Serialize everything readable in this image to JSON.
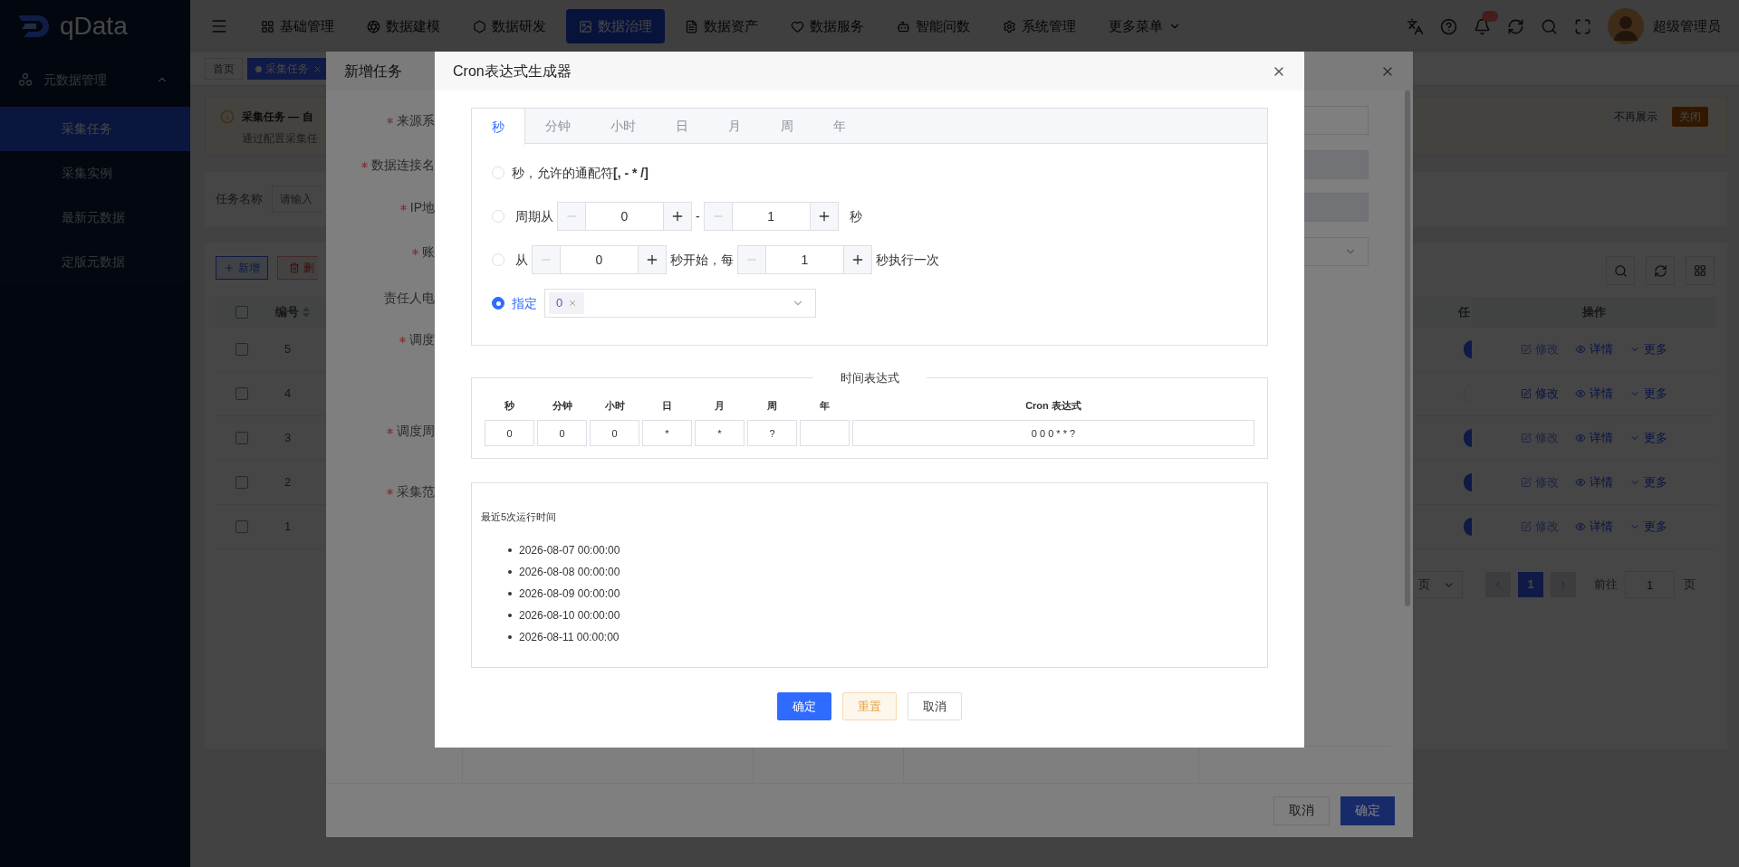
{
  "header": {
    "logo": "qData",
    "nav": [
      {
        "label": "基础管理",
        "selected": false
      },
      {
        "label": "数据建模",
        "selected": false
      },
      {
        "label": "数据研发",
        "selected": false
      },
      {
        "label": "数据治理",
        "selected": true
      },
      {
        "label": "数据资产",
        "selected": false
      },
      {
        "label": "数据服务",
        "selected": false
      },
      {
        "label": "智能问数",
        "selected": false
      },
      {
        "label": "系统管理",
        "selected": false
      }
    ],
    "more": "更多菜单",
    "user": "超级管理员"
  },
  "page_tabs": [
    {
      "label": "首页",
      "selected": false,
      "closable": false
    },
    {
      "label": "采集任务",
      "selected": true,
      "closable": true
    }
  ],
  "sidebar": {
    "group": "元数据管理",
    "expanded": true,
    "items": [
      {
        "label": "采集任务",
        "selected": true
      },
      {
        "label": "采集实例",
        "selected": false
      },
      {
        "label": "最新元数据",
        "selected": false
      },
      {
        "label": "定版元数据",
        "selected": false
      }
    ]
  },
  "alert": {
    "title": "采集任务 — 自",
    "text": "通过配置采集任",
    "dismiss": "不再展示",
    "close": "关闭"
  },
  "search": {
    "label": "任务名称",
    "placeholder": "请输入"
  },
  "toolbar": {
    "add": "新增",
    "delete": "删"
  },
  "table": {
    "columns": [
      "编号",
      "任",
      "操作"
    ],
    "all_checked": false,
    "rows": [
      {
        "id": "5",
        "checked": false,
        "enabled": true,
        "actions": [
          {
            "label": "修改",
            "disabled": true
          },
          {
            "label": "详情",
            "disabled": false
          },
          {
            "label": "更多",
            "disabled": false
          }
        ]
      },
      {
        "id": "4",
        "checked": false,
        "enabled": false,
        "actions": [
          {
            "label": "修改",
            "disabled": false
          },
          {
            "label": "详情",
            "disabled": false
          },
          {
            "label": "更多",
            "disabled": false
          }
        ]
      },
      {
        "id": "3",
        "checked": false,
        "enabled": true,
        "actions": [
          {
            "label": "修改",
            "disabled": true
          },
          {
            "label": "详情",
            "disabled": false
          },
          {
            "label": "更多",
            "disabled": false
          }
        ]
      },
      {
        "id": "2",
        "checked": false,
        "enabled": true,
        "actions": [
          {
            "label": "修改",
            "disabled": true
          },
          {
            "label": "详情",
            "disabled": false
          },
          {
            "label": "更多",
            "disabled": false
          }
        ]
      },
      {
        "id": "1",
        "checked": false,
        "enabled": true,
        "actions": [
          {
            "label": "修改",
            "disabled": true
          },
          {
            "label": "详情",
            "disabled": false
          },
          {
            "label": "更多",
            "disabled": false
          }
        ]
      }
    ]
  },
  "pagination": {
    "size_select": "页",
    "pages": [
      {
        "label": "1",
        "selected": true
      }
    ],
    "goto_label": "前往",
    "goto_value": "1",
    "goto_unit": "页"
  },
  "task_dialog": {
    "title": "新增任务",
    "fields": [
      {
        "label": "来源系",
        "required": true,
        "kind": "input",
        "disabled": false
      },
      {
        "label": "数据连接名",
        "required": true,
        "kind": "input",
        "disabled": true
      },
      {
        "label": "IP地",
        "required": true,
        "kind": "input",
        "disabled": true
      },
      {
        "label": "账",
        "required": true,
        "kind": "select",
        "disabled": false
      },
      {
        "label": "责任人电",
        "required": false,
        "kind": "none"
      },
      {
        "label": "调度",
        "required": true,
        "kind": "none"
      },
      {
        "label": "调度周",
        "required": true,
        "kind": "none"
      },
      {
        "label": "采集范",
        "required": true,
        "kind": "none"
      }
    ],
    "cancel": "取消",
    "confirm": "确定"
  },
  "cron": {
    "title": "Cron表达式生成器",
    "tabs": [
      {
        "label": "秒",
        "selected": true
      },
      {
        "label": "分钟",
        "selected": false
      },
      {
        "label": "小时",
        "selected": false
      },
      {
        "label": "日",
        "selected": false
      },
      {
        "label": "月",
        "selected": false
      },
      {
        "label": "周",
        "selected": false
      },
      {
        "label": "年",
        "selected": false
      }
    ],
    "options": [
      {
        "kind": "text",
        "selected": false,
        "label": "秒，允许的通配符**[, - * /]**"
      },
      {
        "kind": "range",
        "selected": false,
        "prefix": "周期从",
        "from": "0",
        "sep": "-",
        "to": "1",
        "suffix": "秒"
      },
      {
        "kind": "step",
        "selected": false,
        "prefix": "从",
        "start": "0",
        "middle": "秒开始，每",
        "step": "1",
        "suffix": "秒执行一次"
      },
      {
        "kind": "specify",
        "selected": true,
        "label": "指定",
        "tags": [
          "0"
        ]
      }
    ],
    "expression": {
      "legend": "时间表达式",
      "fields": [
        {
          "label": "秒",
          "value": "0"
        },
        {
          "label": "分钟",
          "value": "0"
        },
        {
          "label": "小时",
          "value": "0"
        },
        {
          "label": "日",
          "value": "*"
        },
        {
          "label": "月",
          "value": "*"
        },
        {
          "label": "周",
          "value": "?"
        },
        {
          "label": "年"
        }
      ],
      "cron_label": "Cron 表达式",
      "cron_value": "0 0 0 * * ?"
    },
    "runs": {
      "title": "最近5次运行时间",
      "items": [
        "2026-08-07 00:00:00",
        "2026-08-08 00:00:00",
        "2026-08-09 00:00:00",
        "2026-08-10 00:00:00",
        "2026-08-11 00:00:00"
      ]
    },
    "buttons": [
      {
        "kind": "primary",
        "label": "确定"
      },
      {
        "kind": "warning",
        "label": "重置"
      },
      {
        "kind": "default",
        "label": "取消"
      }
    ]
  }
}
